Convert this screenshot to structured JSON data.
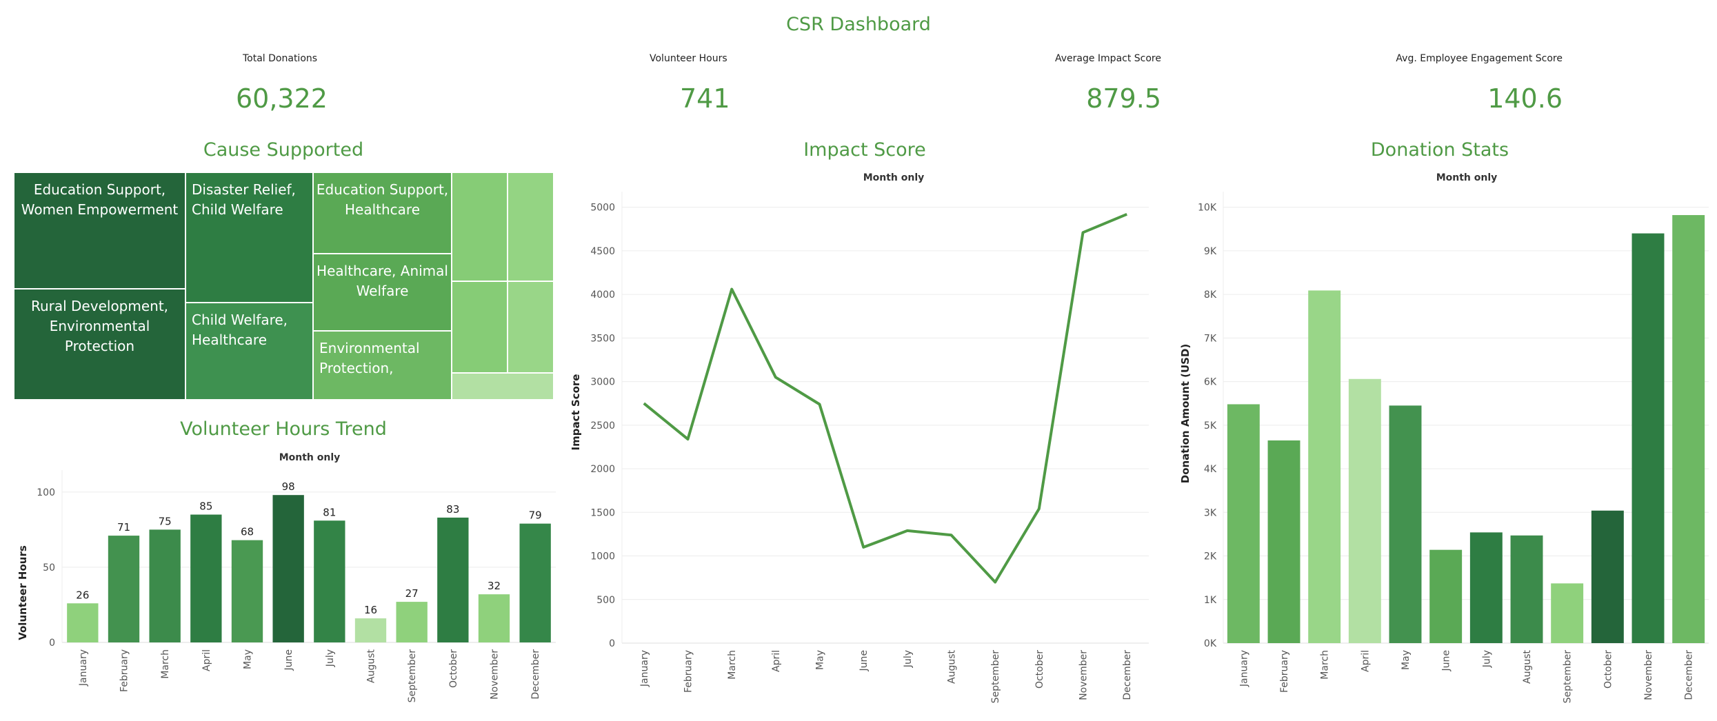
{
  "dashboard": {
    "title": "CSR Dashboard"
  },
  "kpis": [
    {
      "label": "Total Donations",
      "value": "60,322"
    },
    {
      "label": "Volunteer Hours",
      "value": "741"
    },
    {
      "label": "Average Impact Score",
      "value": "879.5"
    },
    {
      "label": "Avg. Employee Engagement Score",
      "value": "140.6"
    }
  ],
  "treemap": {
    "title": "Cause Supported",
    "tiles": [
      {
        "label": "Education Support,\nWomen Empowerment",
        "color": "#24653a"
      },
      {
        "label": "Rural Development,\nEnvironmental\nProtection",
        "color": "#24653a"
      },
      {
        "label": "Disaster Relief,\nChild Welfare",
        "color": "#2e7d43"
      },
      {
        "label": "Child Welfare,\nHealthcare",
        "color": "#3e9150"
      },
      {
        "label": "Education Support,\nHealthcare",
        "color": "#5aa955"
      },
      {
        "label": "Healthcare, Animal\nWelfare",
        "color": "#5aa955"
      },
      {
        "label": "Environmental\nProtection,",
        "color": "#6db863"
      },
      {
        "label": "",
        "color": "#86cc76"
      },
      {
        "label": "",
        "color": "#94d483"
      },
      {
        "label": "",
        "color": "#86cc76"
      },
      {
        "label": "",
        "color": "#99d688"
      },
      {
        "label": "",
        "color": "#b2e0a3"
      }
    ]
  },
  "chart_data": [
    {
      "type": "bar",
      "title": "Volunteer Hours Trend",
      "subtitle": "Month only",
      "xlabel": "",
      "ylabel": "Volunteer Hours",
      "ylim": [
        0,
        110
      ],
      "yticks": [
        0,
        50,
        100
      ],
      "categories": [
        "January",
        "February",
        "March",
        "April",
        "May",
        "June",
        "July",
        "August",
        "September",
        "October",
        "November",
        "December"
      ],
      "values": [
        26,
        71,
        75,
        85,
        68,
        98,
        81,
        16,
        27,
        83,
        32,
        79
      ],
      "colors": [
        "#8fd17c",
        "#43924f",
        "#3c8b4b",
        "#2e7d43",
        "#4a9952",
        "#24653a",
        "#338447",
        "#b2e0a3",
        "#8fd17c",
        "#2e7d43",
        "#8fd17c",
        "#358749"
      ],
      "data_labels": true,
      "grid": true
    },
    {
      "type": "line",
      "title": "Impact Score",
      "subtitle": "Month only",
      "xlabel": "",
      "ylabel": "Impact Score",
      "ylim": [
        0,
        5100
      ],
      "yticks": [
        0,
        500,
        1000,
        1500,
        2000,
        2500,
        3000,
        3500,
        4000,
        4500,
        5000
      ],
      "categories": [
        "January",
        "February",
        "March",
        "April",
        "May",
        "June",
        "July",
        "August",
        "September",
        "October",
        "November",
        "December"
      ],
      "values": [
        2750,
        2340,
        4060,
        3050,
        2740,
        1100,
        1290,
        1240,
        700,
        1540,
        4710,
        4920
      ],
      "color": "#4f9a45",
      "grid": true
    },
    {
      "type": "bar",
      "title": "Donation Stats",
      "subtitle": "Month only",
      "xlabel": "",
      "ylabel": "Donation Amount (USD)",
      "ylim": [
        0,
        10200
      ],
      "yticks": [
        0,
        1000,
        2000,
        3000,
        4000,
        5000,
        6000,
        7000,
        8000,
        9000,
        10000
      ],
      "yticklabels": [
        "0K",
        "1K",
        "2K",
        "3K",
        "4K",
        "5K",
        "6K",
        "7K",
        "8K",
        "9K",
        "10K"
      ],
      "categories": [
        "January",
        "February",
        "March",
        "April",
        "May",
        "June",
        "July",
        "August",
        "September",
        "October",
        "November",
        "December"
      ],
      "values": [
        5480,
        4650,
        8090,
        6060,
        5450,
        2140,
        2540,
        2470,
        1370,
        3040,
        9400,
        9820
      ],
      "colors": [
        "#6db863",
        "#5aa955",
        "#99d688",
        "#b2e0a3",
        "#43924f",
        "#5aa955",
        "#2e7d43",
        "#3c8b4b",
        "#8fd17c",
        "#24653a",
        "#2e7d43",
        "#6db863"
      ],
      "data_labels": false,
      "grid": true
    }
  ]
}
